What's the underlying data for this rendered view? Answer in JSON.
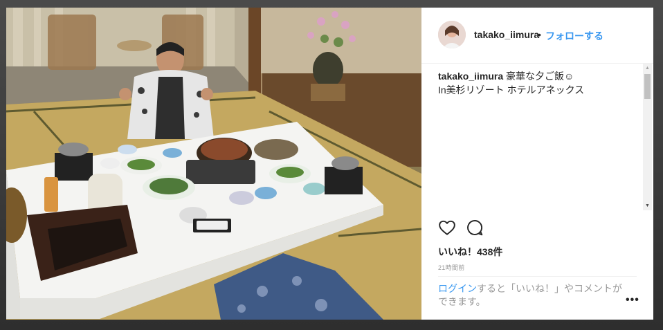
{
  "post": {
    "username": "takako_iimura",
    "separator": "•",
    "follow_label": "フォローする",
    "caption_user": "takako_iimura",
    "caption_line1": " 豪華な夕ご飯☺",
    "caption_line2": "In美杉リゾート ホテルアネックス",
    "likes": "いいね！438件",
    "time": "21時間前",
    "login_link": "ログイン",
    "login_text": "すると「いいね！」やコメントができます。",
    "more_label": "•••"
  },
  "icons": {
    "like": "heart-icon",
    "comment": "comment-icon"
  },
  "colors": {
    "link_blue": "#3897f0",
    "text": "#262626",
    "muted": "#999999"
  }
}
